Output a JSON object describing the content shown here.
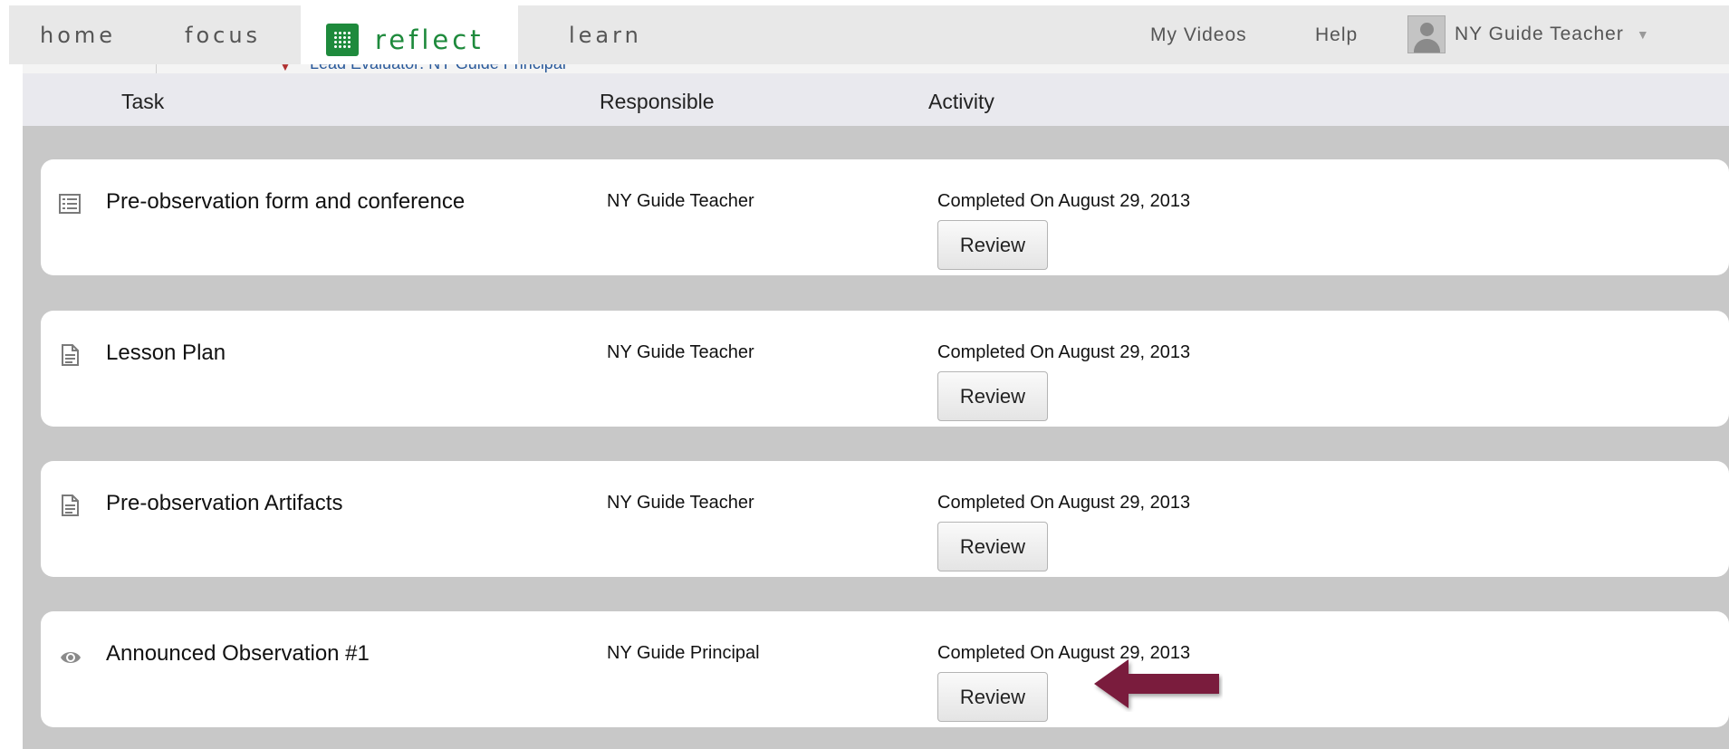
{
  "nav": {
    "tabs": [
      "home",
      "focus",
      "reflect",
      "learn"
    ],
    "active_tab": "reflect",
    "my_videos": "My Videos",
    "help": "Help",
    "user_name": "NY Guide Teacher"
  },
  "breadcrumb": {
    "text": "Lead Evaluator: NY Guide Principal"
  },
  "table": {
    "headers": {
      "task": "Task",
      "responsible": "Responsible",
      "activity": "Activity"
    },
    "rows": [
      {
        "icon": "form-list-icon",
        "task": "Pre-observation form and conference",
        "responsible": "NY Guide Teacher",
        "status": "Completed On August 29, 2013",
        "action": "Review"
      },
      {
        "icon": "document-icon",
        "task": "Lesson Plan",
        "responsible": "NY Guide Teacher",
        "status": "Completed On August 29, 2013",
        "action": "Review"
      },
      {
        "icon": "document-icon",
        "task": "Pre-observation Artifacts",
        "responsible": "NY Guide Teacher",
        "status": "Completed On August 29, 2013",
        "action": "Review"
      },
      {
        "icon": "eye-icon",
        "task": "Announced Observation #1",
        "responsible": "NY Guide Principal",
        "status": "Completed On August 29, 2013",
        "action": "Review"
      }
    ]
  },
  "annotation": {
    "icon": "arrow-left-icon",
    "color": "#7a1f3d"
  },
  "colors": {
    "brand_green": "#1e8a3c",
    "content_bg": "#c8c8c8",
    "header_bg": "#e9e9ee",
    "link_blue": "#2a5a9b"
  }
}
